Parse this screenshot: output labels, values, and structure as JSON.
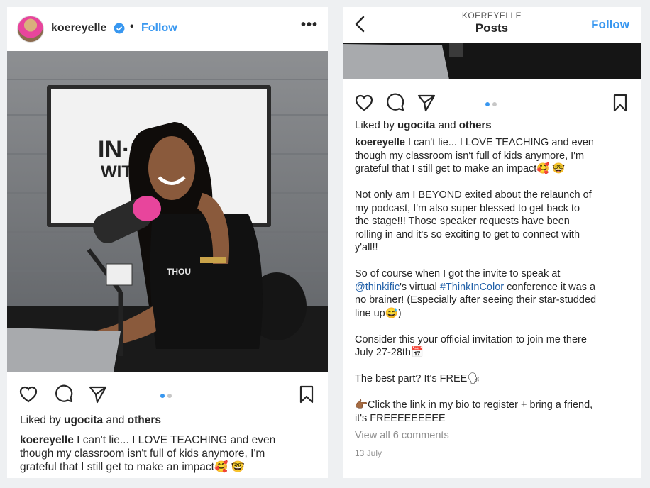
{
  "left_post": {
    "username": "koereyelle",
    "separator": "•",
    "follow_label": "Follow",
    "more_label": "•••",
    "liked_prefix": "Liked by",
    "liked_user": "ugocita",
    "liked_and": "and",
    "liked_others": "others",
    "caption_user": "koereyelle",
    "caption_lines": [
      "I can't lie... I LOVE TEACHING and even",
      "though my classroom isn't full of kids anymore, I'm",
      "grateful that I still get to make an impact🥰 🤓"
    ],
    "photo_sign_top": "IN·ST",
    "photo_sign_bottom": "WITH",
    "photo_shirt_text": "THOU"
  },
  "right_post": {
    "header_small": "KOEREYELLE",
    "header_title": "Posts",
    "follow_label": "Follow",
    "liked_prefix": "Liked by",
    "liked_user": "ugocita",
    "liked_and": "and",
    "liked_others": "others",
    "caption_user": "koereyelle",
    "caption_lines": [
      "I can't lie... I LOVE TEACHING and even",
      "though my classroom isn't full of kids anymore, I'm",
      "grateful that I still get to make an impact🥰 🤓"
    ],
    "para2": [
      "Not only am I BEYOND exited about the relaunch of",
      "my podcast, I'm also super blessed to get back to",
      "the stage!!! Those speaker requests have been",
      "rolling in and it's so exciting to get to connect with",
      "y'all!!"
    ],
    "para3_line1": "So of course when I got the invite to speak at",
    "para3_mention": "@thinkific",
    "para3_mid": "'s virtual",
    "para3_hashtag": "#ThinkInColor",
    "para3_end": "conference it was a",
    "para3_line3": "no brainer! (Especially after seeing their star-studded",
    "para3_line4": "line up😅)",
    "para4": [
      "Consider this your official invitation to join me there",
      "July 27-28th📅"
    ],
    "para5": "The best part? It's FREE🗣",
    "para6": [
      "👉🏾Click the link in my bio to register + bring a friend,",
      "it's FREEEEEEEEE"
    ],
    "view_comments": "View all 6 comments",
    "date": "13 July"
  },
  "icons": {
    "like": "heart-icon",
    "comment": "comment-icon",
    "share": "paper-plane-icon",
    "save": "bookmark-icon",
    "back": "chevron-left-icon",
    "verified": "verified-badge-icon"
  },
  "colors": {
    "link_blue": "#3897f0",
    "hashtag_blue": "#1f5fa8",
    "text": "#262626",
    "muted": "#8e8e8e",
    "page_bg": "#eef0f2",
    "mic_pink": "#e8459c"
  },
  "carousel": {
    "total": 2,
    "active": 1
  }
}
